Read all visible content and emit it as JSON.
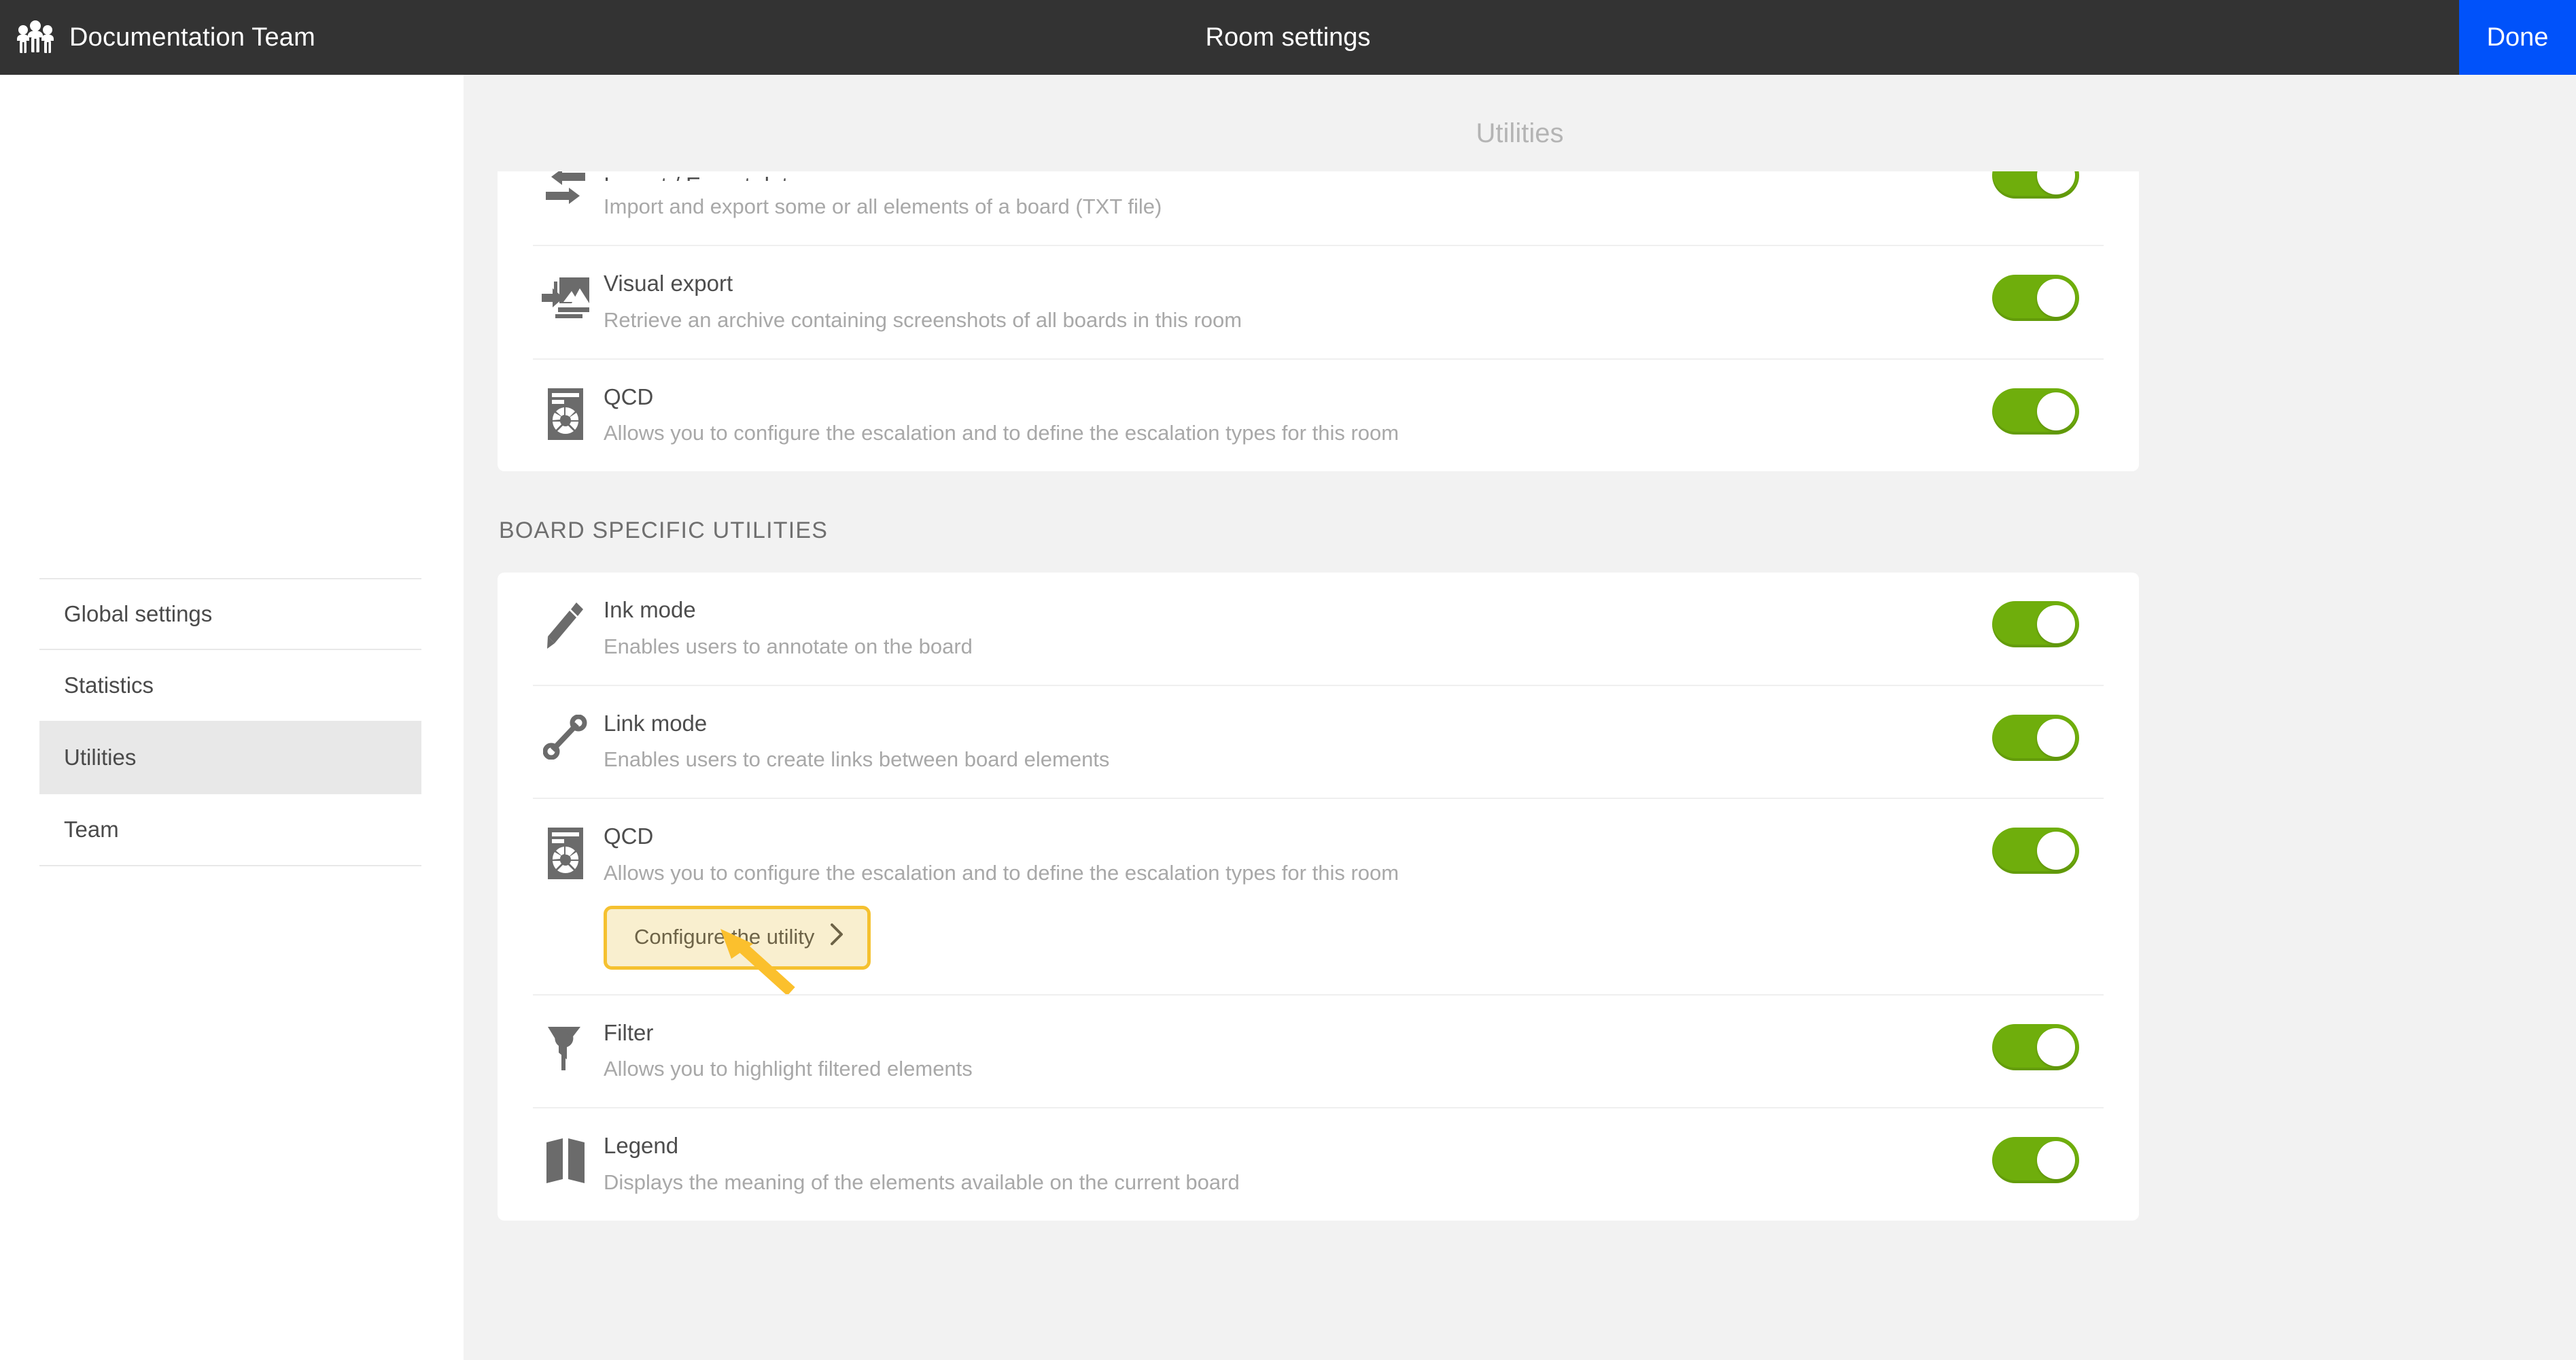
{
  "topbar": {
    "team_icon": "group-people-icon",
    "team_name": "Documentation Team",
    "title": "Room settings",
    "done_label": "Done",
    "done_color": "#0052FA",
    "background": "#333333"
  },
  "sidebar": {
    "items": [
      {
        "label": "Global settings",
        "selected": false
      },
      {
        "label": "Statistics",
        "selected": false
      },
      {
        "label": "Utilities",
        "selected": true
      },
      {
        "label": "Team",
        "selected": false
      }
    ]
  },
  "main": {
    "page_title": "Utilities",
    "toggle_on_color": "#6FAE0C",
    "sections": [
      {
        "id": "general-utilities",
        "header": null,
        "clipped_top": true,
        "rows": [
          {
            "icon": "import-export-icon",
            "title": "Import / Export data",
            "desc": "Import and export some or all elements of a board (TXT file)",
            "toggle": "on",
            "clipped": true
          },
          {
            "icon": "visual-export-icon",
            "title": "Visual export",
            "desc": "Retrieve an archive containing screenshots of all boards in this room",
            "toggle": "on"
          },
          {
            "icon": "qcd-icon",
            "title": "QCD",
            "desc": "Allows you to configure the escalation and to define the escalation types for this room",
            "toggle": "on"
          }
        ]
      },
      {
        "id": "board-specific-utilities",
        "header": "BOARD SPECIFIC UTILITIES",
        "clipped_top": false,
        "rows": [
          {
            "icon": "pencil-icon",
            "title": "Ink mode",
            "desc": "Enables users to annotate on the board",
            "toggle": "on"
          },
          {
            "icon": "link-icon",
            "title": "Link mode",
            "desc": "Enables users to create links between board elements",
            "toggle": "on"
          },
          {
            "icon": "qcd-icon",
            "title": "QCD",
            "desc": "Allows you to configure the escalation and to define the escalation types for this room",
            "toggle": "on",
            "action": {
              "label": "Configure the utility",
              "chevron": "chevron-right-icon",
              "highlighted": true
            }
          },
          {
            "icon": "funnel-icon",
            "title": "Filter",
            "desc": "Allows you to highlight filtered elements",
            "toggle": "on"
          },
          {
            "icon": "legend-book-icon",
            "title": "Legend",
            "desc": "Displays the meaning of the elements available on the current board",
            "toggle": "on"
          }
        ]
      }
    ]
  },
  "annotation": {
    "type": "arrow-pointing-to-configure-button",
    "box_border_color": "#F5C130",
    "box_fill_color": "#F9EFCF",
    "arrow_color": "#FBC02D"
  }
}
